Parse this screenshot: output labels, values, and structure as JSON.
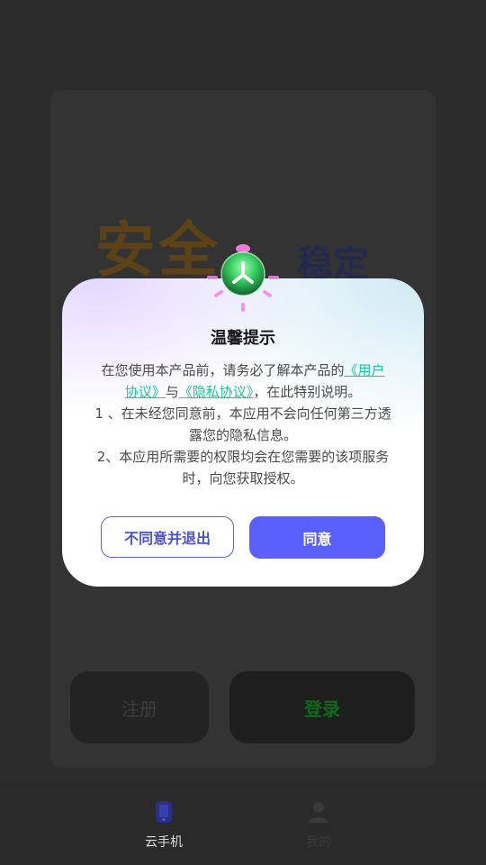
{
  "background": {
    "hero_title": "安全",
    "hero_subtitle": "稳定",
    "register_label": "注册",
    "login_label": "登录"
  },
  "tabbar": {
    "items": [
      {
        "label": "云手机",
        "icon": "phone-icon",
        "active": true
      },
      {
        "label": "我的",
        "icon": "user-icon",
        "active": false
      }
    ]
  },
  "dialog": {
    "title": "温馨提示",
    "intro_prefix": "在您使用本产品前，请务必了解本产品的",
    "user_agreement": "《用户协议》",
    "connector": "与",
    "privacy_agreement": "《隐私协议》",
    "intro_suffix": "，在此特别说明。",
    "point1": "1 、在未经您同意前，本应用不会向任何第三方透露您的隐私信息。",
    "point2": "2、本应用所需要的权限均会在您需要的该项服务时，向您获取授权。",
    "disagree_label": "不同意并退出",
    "agree_label": "同意",
    "badge_icon": "shield-badge-icon"
  },
  "colors": {
    "accent": "#5a60fb",
    "link": "#16c79a",
    "title": "#1a1a1a",
    "body": "#4a4a4a"
  }
}
